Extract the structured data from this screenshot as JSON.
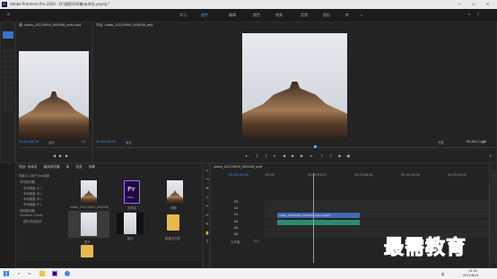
{
  "window": {
    "title": "Adobe Premiere Pro 2020 - D:\\视频\\500集\\未命名.prproj *",
    "min_btn": "—",
    "max_btn": "☐",
    "close_btn": "✕"
  },
  "menu": {
    "items": [
      "文件(F)",
      "编辑(E)",
      "剪辑(C)",
      "序列(S)",
      "标记(M)",
      "图形(G)",
      "视图(V)",
      "窗口(W)",
      "帮助(H)"
    ]
  },
  "workspaces": {
    "home": "⌂",
    "tabs": [
      "学习",
      "组件",
      "编辑",
      "颜色",
      "效果",
      "音频",
      "图形",
      "库"
    ],
    "active": "组件",
    "more": "»"
  },
  "source": {
    "tab_label": "源: video_20220904_000006_edit.mp4",
    "timecode": "00;00;00;00",
    "fit_label": "适合",
    "page_label": "1/2"
  },
  "program": {
    "tab_label": "节目: video_20220904_000006_edit",
    "timecode": "00;00;00;00",
    "fit_label": "适合",
    "quality": "完整",
    "duration": "00;00;11;08"
  },
  "project": {
    "tabs": [
      "项目: 未命名",
      "媒体浏览器",
      "库",
      "信息",
      "效果"
    ],
    "path_label": "电脑(C:)/用户/aa/桌面",
    "tree_items": [
      "本地驱动器",
      "本地磁盘 (C:)",
      "本地磁盘 (D:)",
      "本地磁盘 (E:)",
      "本地磁盘 (F:)",
      "网络驱动器",
      "Creative Cloud",
      "团队项目版本"
    ],
    "assets": [
      {
        "name": "video_20220904_000006_edit.mp4",
        "kind": "video"
      },
      {
        "name": "未命名",
        "kind": "pr",
        "badge": "Pr",
        "badge_sub": "PROJ"
      },
      {
        "name": "视频",
        "kind": "video"
      },
      {
        "name": "图片",
        "kind": "video"
      },
      {
        "name": "图片",
        "kind": "folder"
      },
      {
        "name": "新建文件夹",
        "kind": "folder"
      }
    ]
  },
  "timeline": {
    "tab_label": "video_20220904_000006_edit",
    "timecode": "00;00;00;00",
    "ruler_labels": [
      ";00;00",
      "00;00;04;00",
      "00;00;08;00",
      "00;00;12;00",
      "00;00;16;00"
    ],
    "video_tracks": [
      "V3",
      "V2",
      "V1"
    ],
    "audio_tracks": [
      "A1",
      "A2",
      "A3"
    ],
    "master_label": "主声道",
    "master_value": "0.0",
    "video_clip": "video_20220904_000006_edit.mp4[V]",
    "audio_clip": ""
  },
  "tools": [
    "▸",
    "⇥",
    "✣",
    "◇",
    "✂",
    "↔",
    "✎",
    "✋",
    "T"
  ],
  "watermark": "最需教育",
  "taskbar": {
    "clock_time": "13:16",
    "clock_date": "2022/8/24",
    "start_icon": "windows-logo",
    "tray_lang": "英"
  },
  "colors": {
    "accent": "#4da3ff",
    "timecode": "#3b8eea",
    "video_clip": "#4767b5",
    "audio_clip": "#2b8a72",
    "playhead": "#5fa8ff",
    "watermark": "#2e5cc8"
  }
}
